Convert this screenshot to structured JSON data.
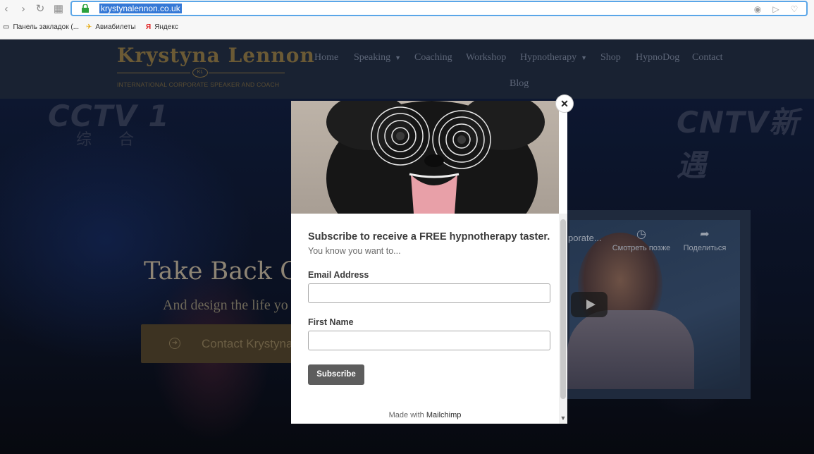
{
  "browser": {
    "url": "krystynalennon.co.uk",
    "bookmarks": [
      {
        "label": "Панель закладок (...",
        "icon": "folder-icon"
      },
      {
        "label": "Авиабилеты",
        "icon": "plane-icon"
      },
      {
        "label": "Яндекс",
        "icon": "yandex-icon"
      }
    ],
    "yandex_glyph": "Я"
  },
  "site": {
    "logo_name": "Krystyna Lennon",
    "logo_badge": "KL",
    "logo_tagline": "INTERNATIONAL CORPORATE SPEAKER AND COACH",
    "nav": [
      "Home",
      "Speaking",
      "Coaching",
      "Workshop",
      "Hypnotherapy",
      "Shop",
      "HypnoDog",
      "Contact",
      "Blog"
    ],
    "hero_heading": "Take Back Co",
    "hero_sub": "And design the life yo",
    "hero_button": "Contact Krystyna",
    "bg_watermarks": [
      "CCTV 1",
      "综 合",
      "CNTV新遇"
    ],
    "video": {
      "title_partial": "porate...",
      "watch_later": "Смотреть позже",
      "share": "Поделиться"
    }
  },
  "popup": {
    "title": "Subscribe to receive a FREE hypnotherapy taster.",
    "subtitle": "You know you want to...",
    "email_label": "Email Address",
    "first_name_label": "First Name",
    "email_value": "",
    "first_name_value": "",
    "subscribe_label": "Subscribe",
    "footer_prefix": "Made with",
    "footer_brand": "Mailchimp"
  },
  "colors": {
    "header_bg": "#192232",
    "gold": "#6b5a35",
    "url_highlight": "#3478d6",
    "subscribe_bg": "#5d5d5d"
  }
}
